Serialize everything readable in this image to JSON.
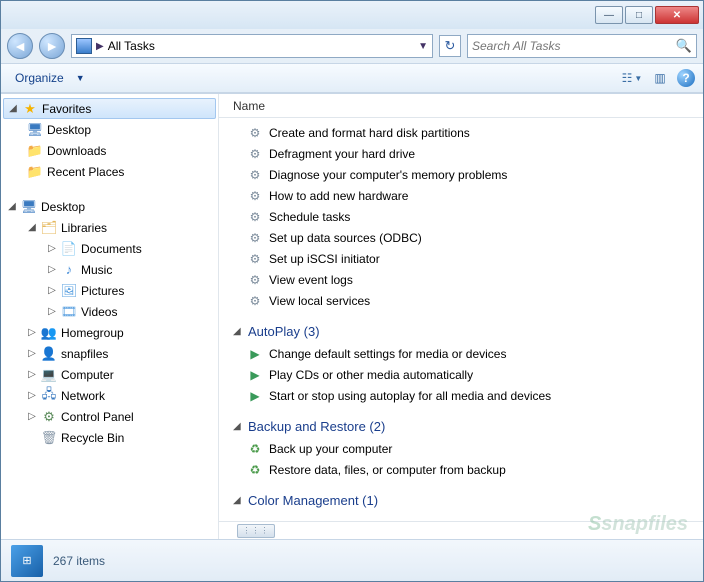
{
  "breadcrumb": {
    "path": "All Tasks"
  },
  "search": {
    "placeholder": "Search All Tasks"
  },
  "toolbar": {
    "organize": "Organize"
  },
  "columns": {
    "name": "Name"
  },
  "sidebar": {
    "favorites": {
      "label": "Favorites",
      "items": [
        "Desktop",
        "Downloads",
        "Recent Places"
      ]
    },
    "desktop": {
      "label": "Desktop",
      "libraries": {
        "label": "Libraries",
        "items": [
          "Documents",
          "Music",
          "Pictures",
          "Videos"
        ]
      },
      "nodes": [
        "Homegroup",
        "snapfiles",
        "Computer",
        "Network",
        "Control Panel",
        "Recycle Bin"
      ]
    }
  },
  "tasks_ungrouped": [
    "Create and format hard disk partitions",
    "Defragment your hard drive",
    "Diagnose your computer's memory problems",
    "How to add new hardware",
    "Schedule tasks",
    "Set up data sources (ODBC)",
    "Set up iSCSI initiator",
    "View event logs",
    "View local services"
  ],
  "groups": [
    {
      "name": "AutoPlay",
      "count": "(3)",
      "items": [
        "Change default settings for media or devices",
        "Play CDs or other media automatically",
        "Start or stop using autoplay for all media and devices"
      ]
    },
    {
      "name": "Backup and Restore",
      "count": "(2)",
      "items": [
        "Back up your computer",
        "Restore data, files, or computer from backup"
      ]
    },
    {
      "name": "Color Management",
      "count": "(1)",
      "items": []
    }
  ],
  "status": {
    "items": "267 items"
  },
  "watermark": "snapfiles"
}
